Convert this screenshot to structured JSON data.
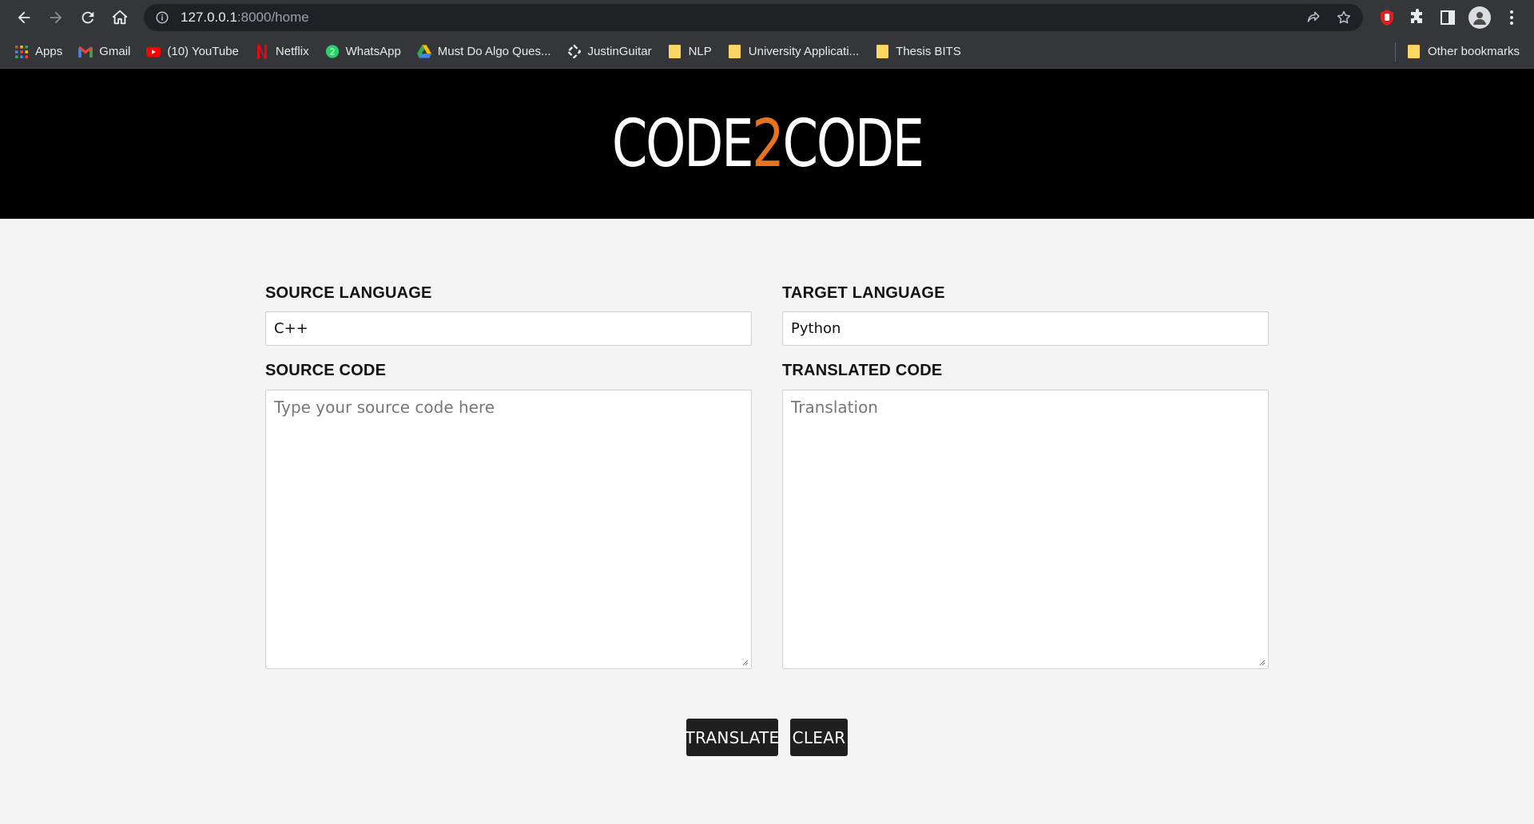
{
  "browser": {
    "url_host": "127.0.0.1",
    "url_path": ":8000/home",
    "bookmarks": [
      {
        "label": "Apps",
        "icon": "apps-grid-icon"
      },
      {
        "label": "Gmail",
        "icon": "gmail-icon"
      },
      {
        "label": "(10) YouTube",
        "icon": "youtube-icon"
      },
      {
        "label": "Netflix",
        "icon": "netflix-icon"
      },
      {
        "label": "WhatsApp",
        "icon": "whatsapp-icon"
      },
      {
        "label": "Must Do Algo Ques...",
        "icon": "google-drive-icon"
      },
      {
        "label": "JustinGuitar",
        "icon": "justinguitar-icon"
      },
      {
        "label": "NLP",
        "icon": "folder-icon"
      },
      {
        "label": "University Applicati...",
        "icon": "folder-icon"
      },
      {
        "label": "Thesis BITS",
        "icon": "folder-icon"
      }
    ],
    "other_bookmarks": "Other bookmarks"
  },
  "header": {
    "logo_part1": "CODE",
    "logo_part2": "2",
    "logo_part3": "CODE",
    "accent_color": "#e8731f"
  },
  "form": {
    "source_language_label": "SOURCE LANGUAGE",
    "source_language_value": "C++",
    "target_language_label": "TARGET LANGUAGE",
    "target_language_value": "Python",
    "source_code_label": "SOURCE CODE",
    "source_code_placeholder": "Type your source code here",
    "translated_code_label": "TRANSLATED CODE",
    "translated_code_placeholder": "Translation",
    "translate_button": "TRANSLATE",
    "clear_button": "CLEAR"
  }
}
